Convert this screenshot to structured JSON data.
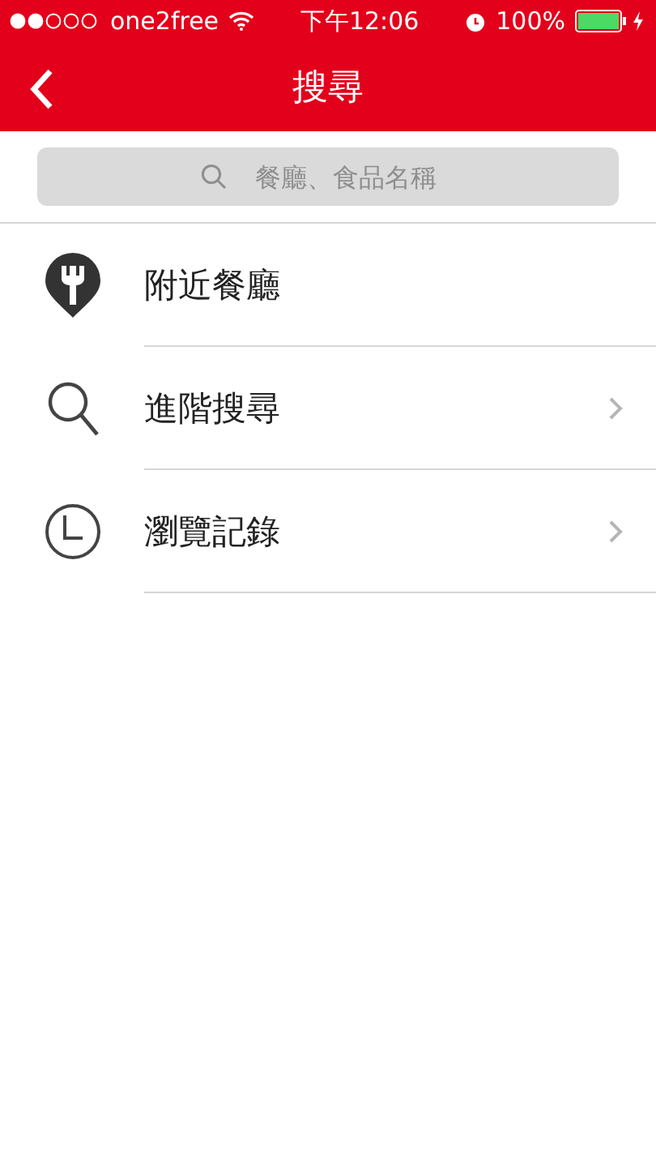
{
  "status_bar": {
    "carrier": "one2free",
    "time": "下午12:06",
    "battery": "100%"
  },
  "nav": {
    "title": "搜尋"
  },
  "search": {
    "placeholder": "餐廳、食品名稱"
  },
  "menu": [
    {
      "kind": "nearby",
      "label": "附近餐廳",
      "chevron": false
    },
    {
      "kind": "search",
      "label": "進階搜尋",
      "chevron": true
    },
    {
      "kind": "history",
      "label": "瀏覽記錄",
      "chevron": true
    }
  ]
}
